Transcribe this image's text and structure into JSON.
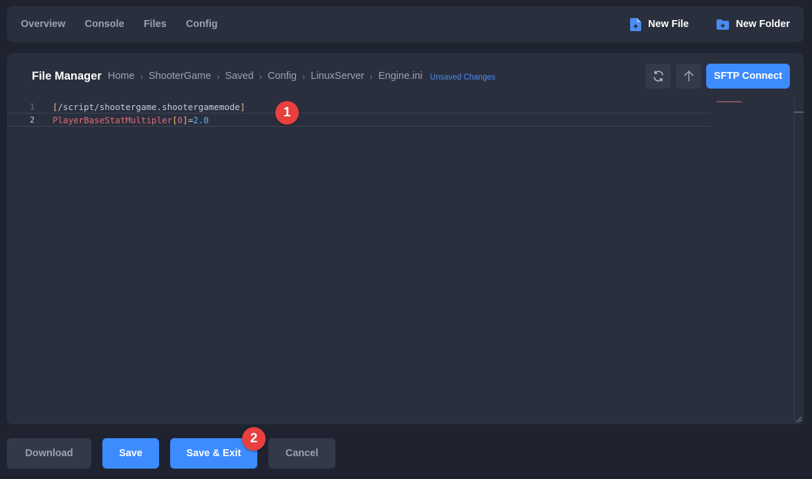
{
  "nav": {
    "tabs": [
      {
        "label": "Overview"
      },
      {
        "label": "Console"
      },
      {
        "label": "Files"
      },
      {
        "label": "Config"
      }
    ],
    "new_file_label": "New File",
    "new_folder_label": "New Folder"
  },
  "file_manager": {
    "title": "File Manager",
    "breadcrumb": [
      "Home",
      "ShooterGame",
      "Saved",
      "Config",
      "LinuxServer",
      "Engine.ini"
    ],
    "unsaved_label": "Unsaved Changes",
    "sftp_label": "SFTP Connect"
  },
  "editor": {
    "lines": [
      {
        "number": "1",
        "open": "[",
        "text": "/script/shootergame.shootergamemode",
        "close": "]"
      },
      {
        "number": "2",
        "key": "PlayerBaseStatMultipler",
        "open": "[",
        "index": "0",
        "close": "]",
        "eq": "=",
        "value": "2.0"
      }
    ]
  },
  "actions": {
    "download_label": "Download",
    "save_label": "Save",
    "save_exit_label": "Save & Exit",
    "cancel_label": "Cancel"
  },
  "markers": [
    "1",
    "2"
  ],
  "colors": {
    "accent": "#3d8bfd",
    "marker": "#e8403f",
    "unsaved": "#4a8cf0"
  }
}
